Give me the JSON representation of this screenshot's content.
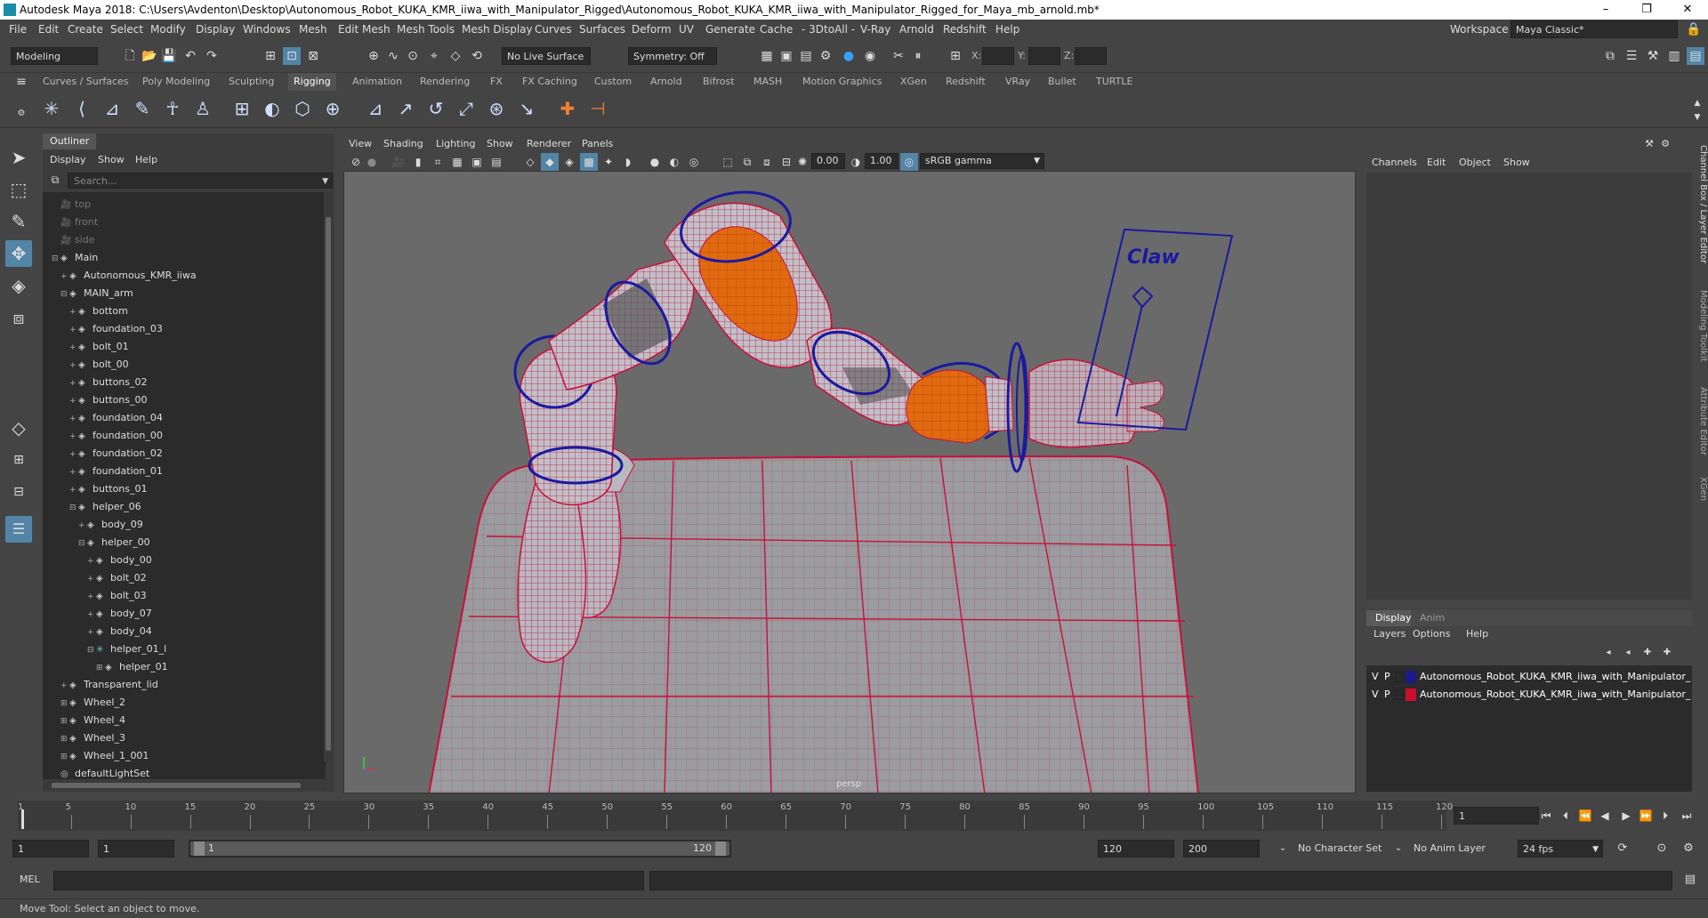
{
  "window": {
    "title": "Autodesk Maya 2018: C:\\Users\\Avdenton\\Desktop\\Autonomous_Robot_KUKA_KMR_iiwa_with_Manipulator_Rigged\\Autonomous_Robot_KUKA_KMR_iiwa_with_Manipulator_Rigged_for_Maya_mb_arnold.mb*",
    "minimize": "–",
    "maximize": "❐",
    "close": "✕"
  },
  "menubar": {
    "items": [
      "File",
      "Edit",
      "Create",
      "Select",
      "Modify",
      "Display",
      "Windows",
      "Mesh",
      "Edit Mesh",
      "Mesh Tools",
      "Mesh Display",
      "Curves",
      "Surfaces",
      "Deform",
      "UV",
      "Generate",
      "Cache",
      "- 3DtoAll -",
      "V-Ray",
      "Arnold",
      "Redshift",
      "Help"
    ],
    "workspace_label": "Workspace :",
    "workspace_value": "Maya Classic*"
  },
  "statusline": {
    "mode": "Modeling",
    "live_surface": "No Live Surface",
    "symmetry": "Symmetry: Off",
    "x_label": "X:",
    "y_label": "Y:",
    "z_label": "Z:"
  },
  "shelf": {
    "tabs": [
      "Curves / Surfaces",
      "Poly Modeling",
      "Sculpting",
      "Rigging",
      "Animation",
      "Rendering",
      "FX",
      "FX Caching",
      "Custom",
      "Arnold",
      "Bifrost",
      "MASH",
      "Motion Graphics",
      "XGen",
      "Redshift",
      "VRay",
      "Bullet",
      "TURTLE"
    ],
    "active_tab": "Rigging"
  },
  "outliner": {
    "title": "Outliner",
    "menus": [
      "Display",
      "Show",
      "Help"
    ],
    "search_placeholder": "Search...",
    "items": [
      {
        "label": "top",
        "indent": 0,
        "dim": true,
        "expander": "",
        "icon": "cam"
      },
      {
        "label": "front",
        "indent": 0,
        "dim": true,
        "expander": "",
        "icon": "cam"
      },
      {
        "label": "side",
        "indent": 0,
        "dim": true,
        "expander": "",
        "icon": "cam"
      },
      {
        "label": "Main",
        "indent": 0,
        "expander": "⊟",
        "icon": "node"
      },
      {
        "label": "Autonomous_KMR_iiwa",
        "indent": 1,
        "expander": "+",
        "icon": "node"
      },
      {
        "label": "MAIN_arm",
        "indent": 1,
        "expander": "⊟",
        "icon": "node"
      },
      {
        "label": "bottom",
        "indent": 2,
        "expander": "+",
        "icon": "node"
      },
      {
        "label": "foundation_03",
        "indent": 2,
        "expander": "+",
        "icon": "node"
      },
      {
        "label": "bolt_01",
        "indent": 2,
        "expander": "+",
        "icon": "node"
      },
      {
        "label": "bolt_00",
        "indent": 2,
        "expander": "+",
        "icon": "node"
      },
      {
        "label": "buttons_02",
        "indent": 2,
        "expander": "+",
        "icon": "node"
      },
      {
        "label": "buttons_00",
        "indent": 2,
        "expander": "+",
        "icon": "node"
      },
      {
        "label": "foundation_04",
        "indent": 2,
        "expander": "+",
        "icon": "node"
      },
      {
        "label": "foundation_00",
        "indent": 2,
        "expander": "+",
        "icon": "node"
      },
      {
        "label": "foundation_02",
        "indent": 2,
        "expander": "+",
        "icon": "node"
      },
      {
        "label": "foundation_01",
        "indent": 2,
        "expander": "+",
        "icon": "node"
      },
      {
        "label": "buttons_01",
        "indent": 2,
        "expander": "+",
        "icon": "node"
      },
      {
        "label": "helper_06",
        "indent": 2,
        "expander": "⊟",
        "icon": "node"
      },
      {
        "label": "body_09",
        "indent": 3,
        "expander": "+",
        "icon": "node"
      },
      {
        "label": "helper_00",
        "indent": 3,
        "expander": "⊟",
        "icon": "node"
      },
      {
        "label": "body_00",
        "indent": 4,
        "expander": "+",
        "icon": "node"
      },
      {
        "label": "bolt_02",
        "indent": 4,
        "expander": "+",
        "icon": "node"
      },
      {
        "label": "bolt_03",
        "indent": 4,
        "expander": "+",
        "icon": "node"
      },
      {
        "label": "body_07",
        "indent": 4,
        "expander": "+",
        "icon": "node"
      },
      {
        "label": "body_04",
        "indent": 4,
        "expander": "+",
        "icon": "node"
      },
      {
        "label": "helper_01_l",
        "indent": 4,
        "expander": "⊟",
        "icon": "ik"
      },
      {
        "label": "helper_01",
        "indent": 5,
        "expander": "⊞",
        "icon": "node"
      },
      {
        "label": "Transparent_lid",
        "indent": 1,
        "expander": "+",
        "icon": "node"
      },
      {
        "label": "Wheel_2",
        "indent": 1,
        "expander": "⊞",
        "icon": "node"
      },
      {
        "label": "Wheel_4",
        "indent": 1,
        "expander": "⊞",
        "icon": "node"
      },
      {
        "label": "Wheel_3",
        "indent": 1,
        "expander": "⊞",
        "icon": "node"
      },
      {
        "label": "Wheel_1_001",
        "indent": 1,
        "expander": "⊞",
        "icon": "node"
      },
      {
        "label": "defaultLightSet",
        "indent": 0,
        "expander": "",
        "icon": "set"
      }
    ]
  },
  "viewport": {
    "menus": [
      "View",
      "Shading",
      "Lighting",
      "Show",
      "Renderer",
      "Panels"
    ],
    "near_value": "0.00",
    "far_value": "1.00",
    "color_space": "sRGB gamma",
    "camera_label": "persp",
    "claw_label": "Claw",
    "colors": {
      "wire": "#c8103a",
      "orange": "#e06a10",
      "ring": "#1a1aa0",
      "bg": "#6a6a6a"
    }
  },
  "channelbox": {
    "menus": [
      "Channels",
      "Edit",
      "Object",
      "Show"
    ]
  },
  "layers": {
    "tabs": [
      "Display",
      "Anim"
    ],
    "active_tab": "Display",
    "menus": [
      "Layers",
      "Options",
      "Help"
    ],
    "rows": [
      {
        "v": "V",
        "p": "P",
        "color": "#1a1a8a",
        "name": "Autonomous_Robot_KUKA_KMR_iiwa_with_Manipulator_"
      },
      {
        "v": "V",
        "p": "P",
        "color": "#c8102e",
        "name": "Autonomous_Robot_KUKA_KMR_iiwa_with_Manipulator_"
      }
    ]
  },
  "side_tabs": [
    "Channel Box / Layer Editor",
    "Modeling Toolkit",
    "Attribute Editor",
    "XGen"
  ],
  "timeline": {
    "ticks": [
      "1",
      "5",
      "10",
      "15",
      "20",
      "25",
      "30",
      "35",
      "40",
      "45",
      "50",
      "55",
      "60",
      "65",
      "70",
      "75",
      "80",
      "85",
      "90",
      "95",
      "100",
      "105",
      "110",
      "115",
      "120"
    ],
    "current_frame": "1"
  },
  "range": {
    "start": "1",
    "playback_start": "1",
    "slider_start": "1",
    "slider_end": "120",
    "playback_end": "120",
    "end": "200",
    "character_set": "No Character Set",
    "anim_layer": "No Anim Layer",
    "fps": "24 fps"
  },
  "command": {
    "label": "MEL"
  },
  "help": {
    "text": "Move Tool: Select an object to move."
  }
}
